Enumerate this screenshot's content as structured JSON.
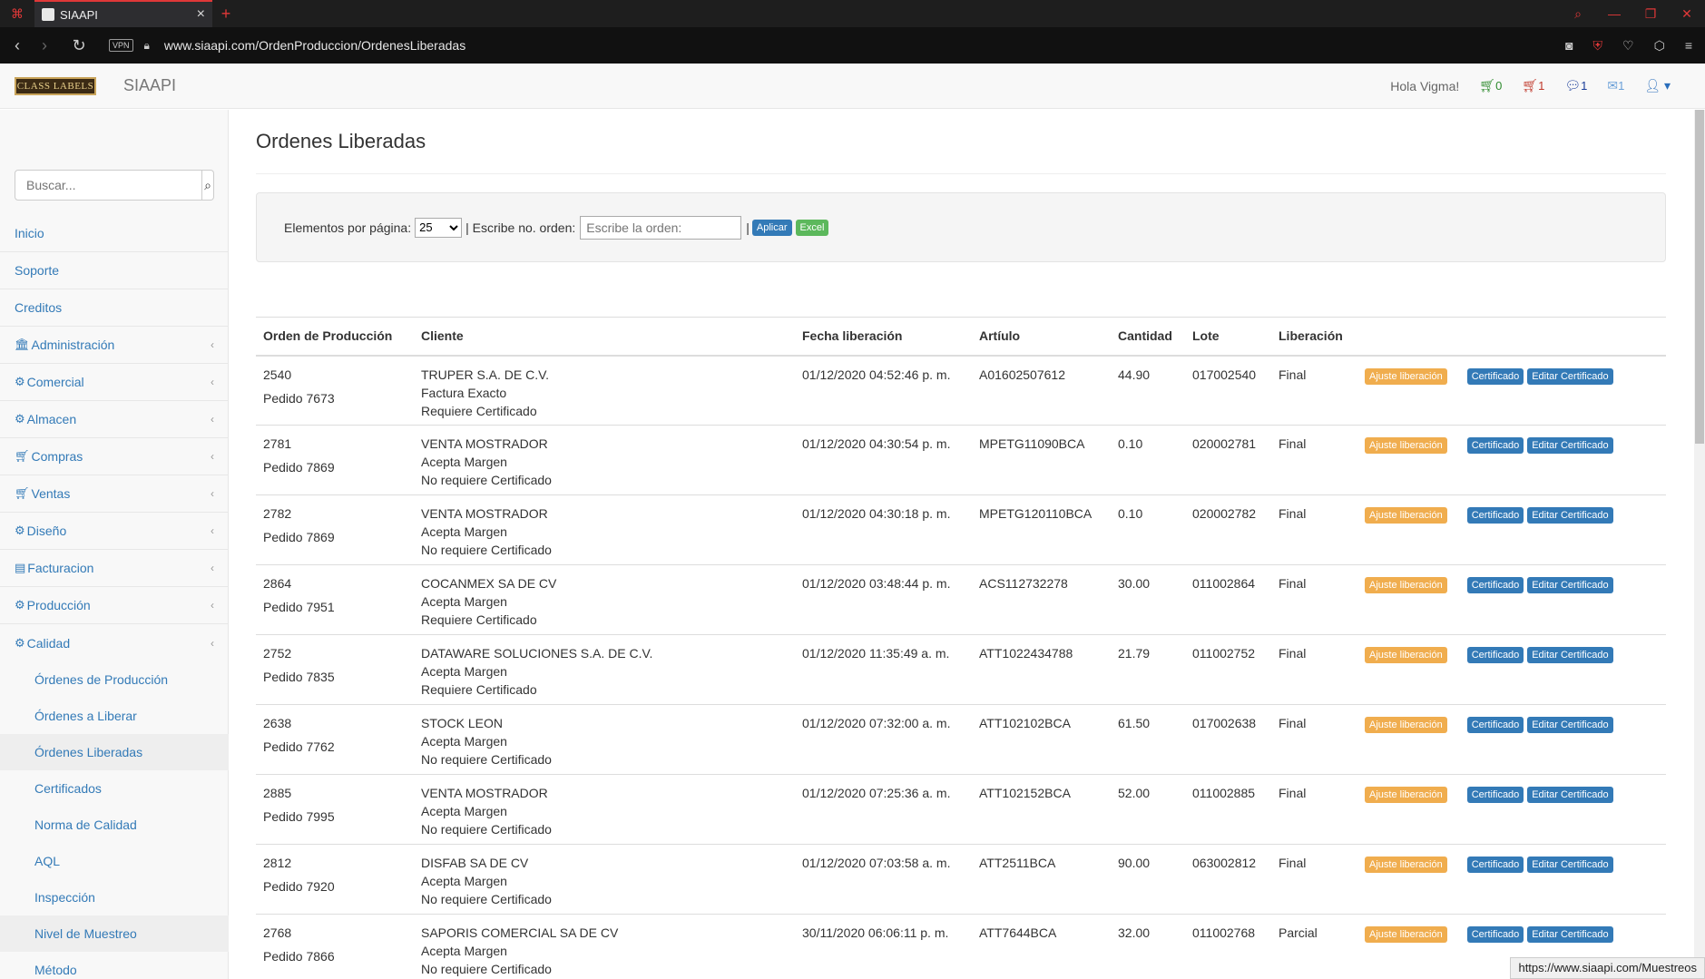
{
  "browser": {
    "tab_title": "SIAAPI",
    "url": "www.siaapi.com/OrdenProduccion/OrdenesLiberadas",
    "vpn_label": "VPN",
    "status_url": "https://www.siaapi.com/Muestreos"
  },
  "header": {
    "logo_text": "CLASS LABELS",
    "brand": "SIAAPI",
    "greeting": "Hola Vigma!",
    "cart_green_count": "0",
    "cart_red_count": "1",
    "messages_count": "1",
    "mail_count": "1"
  },
  "sidebar": {
    "search_placeholder": "Buscar...",
    "items": [
      {
        "label": "Inicio",
        "icon": "none"
      },
      {
        "label": "Soporte",
        "icon": "none"
      },
      {
        "label": "Creditos",
        "icon": "none"
      },
      {
        "label": "Administración",
        "icon": "bank-icon"
      },
      {
        "label": "Comercial",
        "icon": "cubes-icon"
      },
      {
        "label": "Almacen",
        "icon": "cubes-icon"
      },
      {
        "label": "Compras",
        "icon": "basket-icon"
      },
      {
        "label": "Ventas",
        "icon": "basket-icon"
      },
      {
        "label": "Diseño",
        "icon": "cubes-icon"
      },
      {
        "label": "Facturacion",
        "icon": "book-icon"
      },
      {
        "label": "Producción",
        "icon": "cogs-icon"
      },
      {
        "label": "Calidad",
        "icon": "cubes-icon"
      }
    ],
    "subitems": [
      {
        "label": "Órdenes de Producción"
      },
      {
        "label": "Órdenes a Liberar"
      },
      {
        "label": "Órdenes Liberadas"
      },
      {
        "label": "Certificados"
      },
      {
        "label": "Norma de Calidad"
      },
      {
        "label": "AQL"
      },
      {
        "label": "Inspección"
      },
      {
        "label": "Nivel de Muestreo"
      },
      {
        "label": "Método"
      }
    ]
  },
  "main": {
    "title": "Ordenes Liberadas",
    "filter": {
      "per_page_label": "Elementos por página:",
      "per_page_value": "25",
      "order_label": "| Escribe no. orden:",
      "order_placeholder": "Escribe la orden:",
      "separator": "|",
      "apply_label": "Aplicar",
      "excel_label": "Excel"
    },
    "table": {
      "headers": [
        "Orden de Producción",
        "Cliente",
        "Fecha liberación",
        "Artíulo",
        "Cantidad",
        "Lote",
        "Liberación"
      ],
      "ajuste_label": "Ajuste liberación",
      "cert_label": "Certificado",
      "edit_cert_label": "Editar Certificado",
      "rows": [
        {
          "orden": "2540",
          "pedido": "Pedido 7673",
          "cliente": "TRUPER S.A. DE C.V.",
          "c2": "Factura Exacto",
          "c3": "Requiere Certificado",
          "fecha": "01/12/2020 04:52:46 p. m.",
          "articulo": "A01602507612",
          "cantidad": "44.90",
          "lote": "017002540",
          "liberacion": "Final"
        },
        {
          "orden": "2781",
          "pedido": "Pedido 7869",
          "cliente": "VENTA MOSTRADOR",
          "c2": "Acepta Margen",
          "c3": "No requiere Certificado",
          "fecha": "01/12/2020 04:30:54 p. m.",
          "articulo": "MPETG11090BCA",
          "cantidad": "0.10",
          "lote": "020002781",
          "liberacion": "Final"
        },
        {
          "orden": "2782",
          "pedido": "Pedido 7869",
          "cliente": "VENTA MOSTRADOR",
          "c2": "Acepta Margen",
          "c3": "No requiere Certificado",
          "fecha": "01/12/2020 04:30:18 p. m.",
          "articulo": "MPETG120110BCA",
          "cantidad": "0.10",
          "lote": "020002782",
          "liberacion": "Final"
        },
        {
          "orden": "2864",
          "pedido": "Pedido 7951",
          "cliente": "COCANMEX SA DE CV",
          "c2": "Acepta Margen",
          "c3": "Requiere Certificado",
          "fecha": "01/12/2020 03:48:44 p. m.",
          "articulo": "ACS112732278",
          "cantidad": "30.00",
          "lote": "011002864",
          "liberacion": "Final"
        },
        {
          "orden": "2752",
          "pedido": "Pedido 7835",
          "cliente": "DATAWARE SOLUCIONES S.A. DE C.V.",
          "c2": "Acepta Margen",
          "c3": "Requiere Certificado",
          "fecha": "01/12/2020 11:35:49 a. m.",
          "articulo": "ATT1022434788",
          "cantidad": "21.79",
          "lote": "011002752",
          "liberacion": "Final"
        },
        {
          "orden": "2638",
          "pedido": "Pedido 7762",
          "cliente": "STOCK LEON",
          "c2": "Acepta Margen",
          "c3": "No requiere Certificado",
          "fecha": "01/12/2020 07:32:00 a. m.",
          "articulo": "ATT102102BCA",
          "cantidad": "61.50",
          "lote": "017002638",
          "liberacion": "Final"
        },
        {
          "orden": "2885",
          "pedido": "Pedido 7995",
          "cliente": "VENTA MOSTRADOR",
          "c2": "Acepta Margen",
          "c3": "No requiere Certificado",
          "fecha": "01/12/2020 07:25:36 a. m.",
          "articulo": "ATT102152BCA",
          "cantidad": "52.00",
          "lote": "011002885",
          "liberacion": "Final"
        },
        {
          "orden": "2812",
          "pedido": "Pedido 7920",
          "cliente": "DISFAB SA DE CV",
          "c2": "Acepta Margen",
          "c3": "No requiere Certificado",
          "fecha": "01/12/2020 07:03:58 a. m.",
          "articulo": "ATT2511BCA",
          "cantidad": "90.00",
          "lote": "063002812",
          "liberacion": "Final"
        },
        {
          "orden": "2768",
          "pedido": "Pedido 7866",
          "cliente": "SAPORIS COMERCIAL SA DE CV",
          "c2": "Acepta Margen",
          "c3": "No requiere Certificado",
          "fecha": "30/11/2020 06:06:11 p. m.",
          "articulo": "ATT7644BCA",
          "cantidad": "32.00",
          "lote": "011002768",
          "liberacion": "Parcial"
        }
      ]
    }
  },
  "colors": {
    "link": "#337ab7",
    "warning": "#f0ad4e",
    "success": "#5cb85c",
    "accent": "#e03838"
  }
}
